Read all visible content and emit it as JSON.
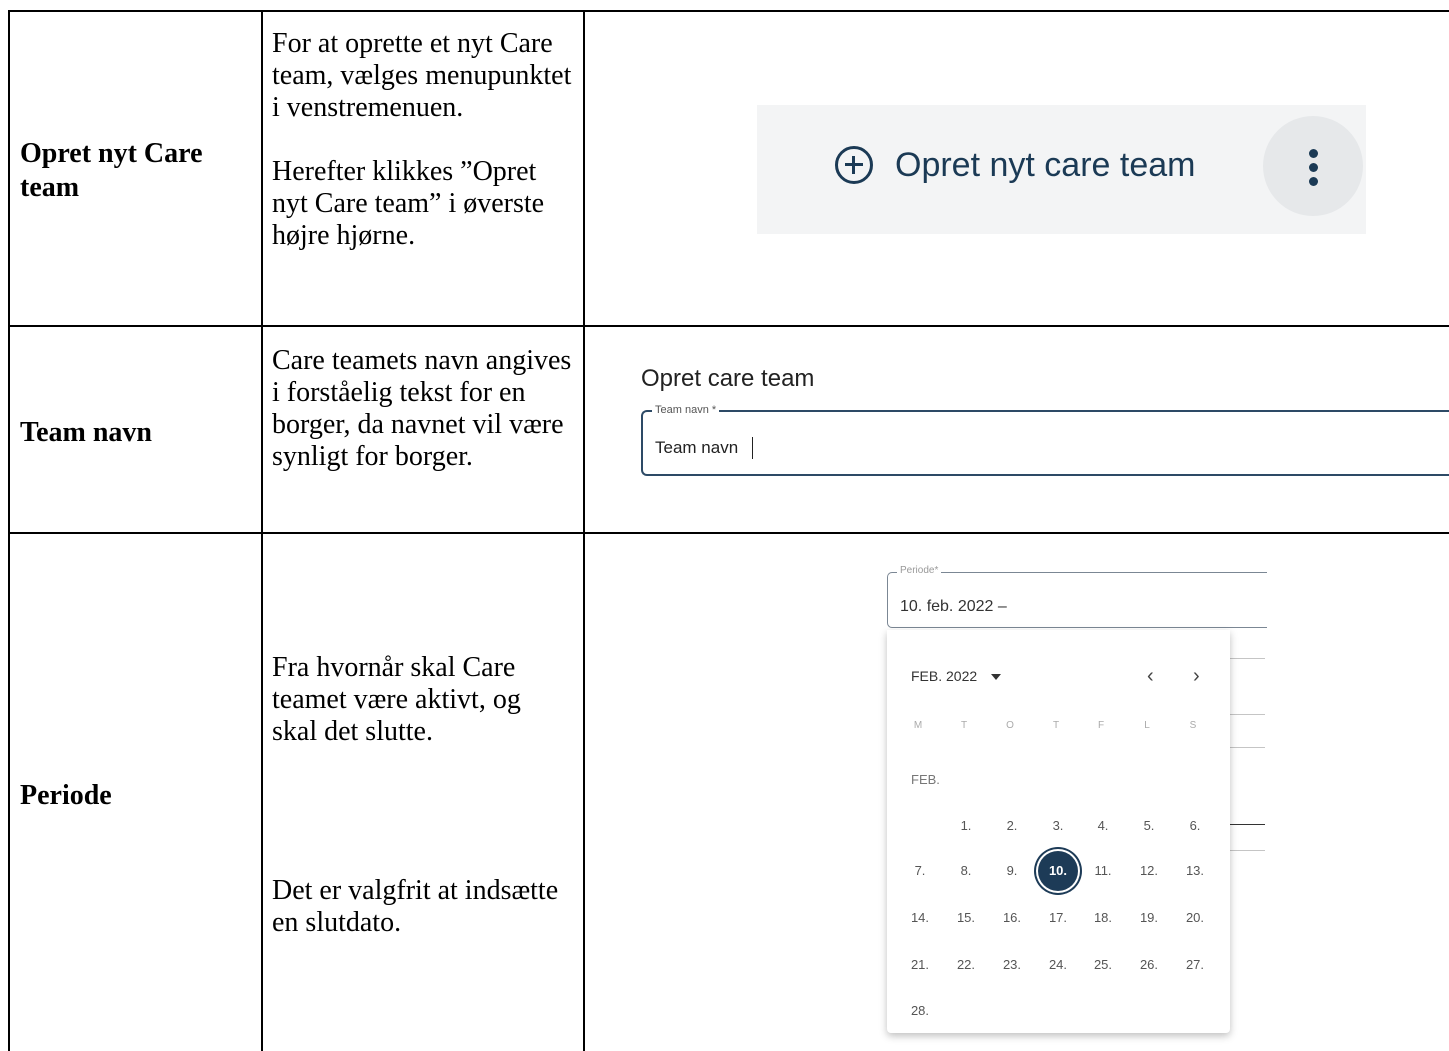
{
  "rows": [
    {
      "label": "Opret nyt Care team",
      "description": "For at oprette et nyt Care team, vælges menupunktet i venstremenuen.\n\nHerefter klikkes ”Opret nyt Care team” i øverste højre hjørne."
    },
    {
      "label": "Team navn",
      "description": "Care teamets navn angives i forståelig tekst for en borger, da navnet vil være synligt for borger."
    },
    {
      "label": "Periode",
      "description_1": "Fra hvornår skal Care teamet være aktivt, og skal det slutte.",
      "description_2": "Det er valgfrit at indsætte en slutdato."
    }
  ],
  "menu_button": {
    "label": "Opret nyt care team",
    "icon": "plus-circle-icon",
    "more_icon": "kebab-menu-icon",
    "accent_color": "#1b3a55"
  },
  "team_form": {
    "title": "Opret care team",
    "field_label": "Team navn *",
    "field_value": "Team navn"
  },
  "period_form": {
    "field_label": "Periode*",
    "field_value": "10. feb. 2022 –",
    "calendar": {
      "month_label": "FEB. 2022",
      "prev_icon": "chevron-left-icon",
      "next_icon": "chevron-right-icon",
      "weekdays": [
        "M",
        "T",
        "O",
        "T",
        "F",
        "L",
        "S"
      ],
      "section_label": "FEB.",
      "selected_day": "10.",
      "selected_color": "#1d3b57",
      "weeks": [
        [
          "",
          "1.",
          "2.",
          "3.",
          "4.",
          "5.",
          "6."
        ],
        [
          "7.",
          "8.",
          "9.",
          "10.",
          "11.",
          "12.",
          "13."
        ],
        [
          "14.",
          "15.",
          "16.",
          "17.",
          "18.",
          "19.",
          "20."
        ],
        [
          "21.",
          "22.",
          "23.",
          "24.",
          "25.",
          "26.",
          "27."
        ],
        [
          "28.",
          "",
          "",
          "",
          "",
          "",
          ""
        ]
      ]
    }
  }
}
